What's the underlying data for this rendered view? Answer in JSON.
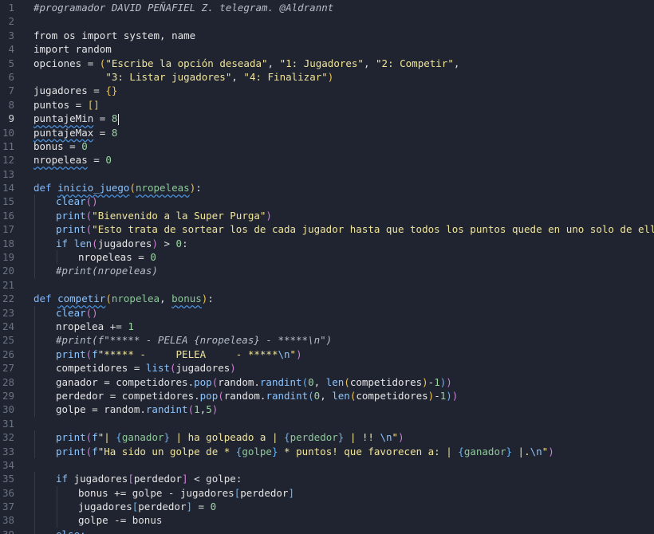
{
  "editor": {
    "active_line": 9,
    "lines": [
      {
        "n": "1",
        "indent": 0,
        "tokens": [
          {
            "t": "#programador DAVID PEÑAFIEL Z. telegram. @Aldrannt",
            "c": "t-comment"
          }
        ]
      },
      {
        "n": "2",
        "indent": 0,
        "tokens": []
      },
      {
        "n": "3",
        "indent": 0,
        "tokens": [
          {
            "t": "from",
            "c": "t-var"
          },
          {
            "t": " os ",
            "c": "t-var"
          },
          {
            "t": "import",
            "c": "t-var"
          },
          {
            "t": " system, name",
            "c": "t-var"
          }
        ]
      },
      {
        "n": "4",
        "indent": 0,
        "tokens": [
          {
            "t": "import random",
            "c": "t-var"
          }
        ]
      },
      {
        "n": "5",
        "indent": 0,
        "tokens": [
          {
            "t": "opciones",
            "c": "t-var"
          },
          {
            "t": " = ",
            "c": "t-op"
          },
          {
            "t": "(",
            "c": "t-bracket"
          },
          {
            "t": "\"Escribe la opción deseada\"",
            "c": "t-str"
          },
          {
            "t": ", ",
            "c": "t-op"
          },
          {
            "t": "\"1: Jugadores\"",
            "c": "t-str"
          },
          {
            "t": ", ",
            "c": "t-op"
          },
          {
            "t": "\"2: Competir\"",
            "c": "t-str"
          },
          {
            "t": ",",
            "c": "t-op"
          }
        ]
      },
      {
        "n": "6",
        "indent": 0,
        "tokens": [
          {
            "t": "            ",
            "c": "t-op"
          },
          {
            "t": "\"3: Listar jugadores\"",
            "c": "t-str"
          },
          {
            "t": ", ",
            "c": "t-op"
          },
          {
            "t": "\"4: Finalizar\"",
            "c": "t-str"
          },
          {
            "t": ")",
            "c": "t-bracket"
          }
        ]
      },
      {
        "n": "7",
        "indent": 0,
        "tokens": [
          {
            "t": "jugadores",
            "c": "t-var"
          },
          {
            "t": " = ",
            "c": "t-op"
          },
          {
            "t": "{}",
            "c": "t-bracket"
          }
        ]
      },
      {
        "n": "8",
        "indent": 0,
        "tokens": [
          {
            "t": "puntos",
            "c": "t-var"
          },
          {
            "t": " = ",
            "c": "t-op"
          },
          {
            "t": "[]",
            "c": "t-bracket"
          }
        ]
      },
      {
        "n": "9",
        "indent": 0,
        "tokens": [
          {
            "t": "puntajeMin",
            "c": "t-var squig"
          },
          {
            "t": " = ",
            "c": "t-op"
          },
          {
            "t": "8",
            "c": "t-num"
          }
        ]
      },
      {
        "n": "10",
        "indent": 0,
        "tokens": [
          {
            "t": "puntajeMax",
            "c": "t-var squig"
          },
          {
            "t": " = ",
            "c": "t-op"
          },
          {
            "t": "8",
            "c": "t-num"
          }
        ]
      },
      {
        "n": "11",
        "indent": 0,
        "tokens": [
          {
            "t": "bonus",
            "c": "t-var"
          },
          {
            "t": " = ",
            "c": "t-op"
          },
          {
            "t": "0",
            "c": "t-num"
          }
        ]
      },
      {
        "n": "12",
        "indent": 0,
        "tokens": [
          {
            "t": "nropeleas",
            "c": "t-var squig"
          },
          {
            "t": " = ",
            "c": "t-op"
          },
          {
            "t": "0",
            "c": "t-num"
          }
        ]
      },
      {
        "n": "13",
        "indent": 0,
        "tokens": []
      },
      {
        "n": "14",
        "indent": 0,
        "tokens": [
          {
            "t": "def",
            "c": "t-def"
          },
          {
            "t": " ",
            "c": "t-op"
          },
          {
            "t": "inicio_juego",
            "c": "t-fname squig"
          },
          {
            "t": "(",
            "c": "t-bracket"
          },
          {
            "t": "nropeleas",
            "c": "t-param squig"
          },
          {
            "t": ")",
            "c": "t-bracket"
          },
          {
            "t": ":",
            "c": "t-op"
          }
        ]
      },
      {
        "n": "15",
        "indent": 1,
        "tokens": [
          {
            "t": "clear",
            "c": "t-fn"
          },
          {
            "t": "()",
            "c": "t-bracket2"
          }
        ]
      },
      {
        "n": "16",
        "indent": 1,
        "tokens": [
          {
            "t": "print",
            "c": "t-fn"
          },
          {
            "t": "(",
            "c": "t-bracket2"
          },
          {
            "t": "\"Bienvenido a la Super Purga\"",
            "c": "t-str"
          },
          {
            "t": ")",
            "c": "t-bracket2"
          }
        ]
      },
      {
        "n": "17",
        "indent": 1,
        "tokens": [
          {
            "t": "print",
            "c": "t-fn"
          },
          {
            "t": "(",
            "c": "t-bracket2"
          },
          {
            "t": "\"Esto trata de sortear los de cada jugador hasta que todos los puntos quede en uno solo de ellos.\"",
            "c": "t-str"
          },
          {
            "t": ")",
            "c": "t-bracket2"
          }
        ]
      },
      {
        "n": "18",
        "indent": 1,
        "tokens": [
          {
            "t": "if",
            "c": "t-kw"
          },
          {
            "t": " ",
            "c": "t-op"
          },
          {
            "t": "len",
            "c": "t-fn"
          },
          {
            "t": "(",
            "c": "t-bracket2"
          },
          {
            "t": "jugadores",
            "c": "t-var"
          },
          {
            "t": ")",
            "c": "t-bracket2"
          },
          {
            "t": " > ",
            "c": "t-op"
          },
          {
            "t": "0",
            "c": "t-num"
          },
          {
            "t": ":",
            "c": "t-op"
          }
        ]
      },
      {
        "n": "19",
        "indent": 2,
        "tokens": [
          {
            "t": "nropeleas",
            "c": "t-var"
          },
          {
            "t": " = ",
            "c": "t-op"
          },
          {
            "t": "0",
            "c": "t-num"
          }
        ]
      },
      {
        "n": "20",
        "indent": 1,
        "tokens": [
          {
            "t": "#print(nropeleas)",
            "c": "t-comment"
          }
        ]
      },
      {
        "n": "21",
        "indent": 0,
        "tokens": []
      },
      {
        "n": "22",
        "indent": 0,
        "tokens": [
          {
            "t": "def",
            "c": "t-def"
          },
          {
            "t": " ",
            "c": "t-op"
          },
          {
            "t": "competir",
            "c": "t-fname squig"
          },
          {
            "t": "(",
            "c": "t-bracket"
          },
          {
            "t": "nropelea",
            "c": "t-param"
          },
          {
            "t": ", ",
            "c": "t-op"
          },
          {
            "t": "bonus",
            "c": "t-param squig"
          },
          {
            "t": ")",
            "c": "t-bracket"
          },
          {
            "t": ":",
            "c": "t-op"
          }
        ]
      },
      {
        "n": "23",
        "indent": 1,
        "tokens": [
          {
            "t": "clear",
            "c": "t-fn"
          },
          {
            "t": "()",
            "c": "t-bracket2"
          }
        ]
      },
      {
        "n": "24",
        "indent": 1,
        "tokens": [
          {
            "t": "nropelea",
            "c": "t-var"
          },
          {
            "t": " += ",
            "c": "t-op"
          },
          {
            "t": "1",
            "c": "t-num"
          }
        ]
      },
      {
        "n": "25",
        "indent": 1,
        "tokens": [
          {
            "t": "#print(f\"***** - PELEA {nropeleas} - *****\\n\")",
            "c": "t-comment"
          }
        ]
      },
      {
        "n": "26",
        "indent": 1,
        "tokens": [
          {
            "t": "print",
            "c": "t-fn"
          },
          {
            "t": "(",
            "c": "t-bracket2"
          },
          {
            "t": "f",
            "c": "t-kw"
          },
          {
            "t": "\"***** -     PELEA     - *****",
            "c": "t-str"
          },
          {
            "t": "\\n",
            "c": "t-escape"
          },
          {
            "t": "\"",
            "c": "t-str"
          },
          {
            "t": ")",
            "c": "t-bracket2"
          }
        ]
      },
      {
        "n": "27",
        "indent": 1,
        "tokens": [
          {
            "t": "competidores",
            "c": "t-var"
          },
          {
            "t": " = ",
            "c": "t-op"
          },
          {
            "t": "list",
            "c": "t-fn"
          },
          {
            "t": "(",
            "c": "t-bracket2"
          },
          {
            "t": "jugadores",
            "c": "t-var"
          },
          {
            "t": ")",
            "c": "t-bracket2"
          }
        ]
      },
      {
        "n": "28",
        "indent": 1,
        "tokens": [
          {
            "t": "ganador",
            "c": "t-var"
          },
          {
            "t": " = competidores.",
            "c": "t-op"
          },
          {
            "t": "pop",
            "c": "t-fn"
          },
          {
            "t": "(",
            "c": "t-bracket2"
          },
          {
            "t": "random.",
            "c": "t-var"
          },
          {
            "t": "randint",
            "c": "t-fn"
          },
          {
            "t": "(",
            "c": "t-bracket3"
          },
          {
            "t": "0",
            "c": "t-num"
          },
          {
            "t": ", ",
            "c": "t-op"
          },
          {
            "t": "len",
            "c": "t-fn"
          },
          {
            "t": "(",
            "c": "t-bracket"
          },
          {
            "t": "competidores",
            "c": "t-var"
          },
          {
            "t": ")",
            "c": "t-bracket"
          },
          {
            "t": "-",
            "c": "t-op"
          },
          {
            "t": "1",
            "c": "t-num"
          },
          {
            "t": ")",
            "c": "t-bracket3"
          },
          {
            "t": ")",
            "c": "t-bracket2"
          }
        ]
      },
      {
        "n": "29",
        "indent": 1,
        "tokens": [
          {
            "t": "perdedor",
            "c": "t-var"
          },
          {
            "t": " = competidores.",
            "c": "t-op"
          },
          {
            "t": "pop",
            "c": "t-fn"
          },
          {
            "t": "(",
            "c": "t-bracket2"
          },
          {
            "t": "random.",
            "c": "t-var"
          },
          {
            "t": "randint",
            "c": "t-fn"
          },
          {
            "t": "(",
            "c": "t-bracket3"
          },
          {
            "t": "0",
            "c": "t-num"
          },
          {
            "t": ", ",
            "c": "t-op"
          },
          {
            "t": "len",
            "c": "t-fn"
          },
          {
            "t": "(",
            "c": "t-bracket"
          },
          {
            "t": "competidores",
            "c": "t-var"
          },
          {
            "t": ")",
            "c": "t-bracket"
          },
          {
            "t": "-",
            "c": "t-op"
          },
          {
            "t": "1",
            "c": "t-num"
          },
          {
            "t": ")",
            "c": "t-bracket3"
          },
          {
            "t": ")",
            "c": "t-bracket2"
          }
        ]
      },
      {
        "n": "30",
        "indent": 1,
        "tokens": [
          {
            "t": "golpe",
            "c": "t-var"
          },
          {
            "t": " = random.",
            "c": "t-op"
          },
          {
            "t": "randint",
            "c": "t-fn"
          },
          {
            "t": "(",
            "c": "t-bracket2"
          },
          {
            "t": "1",
            "c": "t-num"
          },
          {
            "t": ",",
            "c": "t-op"
          },
          {
            "t": "5",
            "c": "t-num"
          },
          {
            "t": ")",
            "c": "t-bracket2"
          }
        ]
      },
      {
        "n": "31",
        "indent": 0,
        "tokens": []
      },
      {
        "n": "32",
        "indent": 1,
        "tokens": [
          {
            "t": "print",
            "c": "t-fn"
          },
          {
            "t": "(",
            "c": "t-bracket2"
          },
          {
            "t": "f",
            "c": "t-kw"
          },
          {
            "t": "\"| ",
            "c": "t-str"
          },
          {
            "t": "{",
            "c": "t-bracket3"
          },
          {
            "t": "ganador",
            "c": "t-param"
          },
          {
            "t": "}",
            "c": "t-bracket3"
          },
          {
            "t": " | ha golpeado a | ",
            "c": "t-str"
          },
          {
            "t": "{",
            "c": "t-bracket3"
          },
          {
            "t": "perdedor",
            "c": "t-param"
          },
          {
            "t": "}",
            "c": "t-bracket3"
          },
          {
            "t": " | !! ",
            "c": "t-str"
          },
          {
            "t": "\\n",
            "c": "t-escape"
          },
          {
            "t": "\"",
            "c": "t-str"
          },
          {
            "t": ")",
            "c": "t-bracket2"
          }
        ]
      },
      {
        "n": "33",
        "indent": 1,
        "tokens": [
          {
            "t": "print",
            "c": "t-fn"
          },
          {
            "t": "(",
            "c": "t-bracket2"
          },
          {
            "t": "f",
            "c": "t-kw"
          },
          {
            "t": "\"Ha sido un golpe de * ",
            "c": "t-str"
          },
          {
            "t": "{",
            "c": "t-bracket3"
          },
          {
            "t": "golpe",
            "c": "t-param"
          },
          {
            "t": "}",
            "c": "t-bracket3"
          },
          {
            "t": " * puntos! que favorecen a: | ",
            "c": "t-str"
          },
          {
            "t": "{",
            "c": "t-bracket3"
          },
          {
            "t": "ganador",
            "c": "t-param"
          },
          {
            "t": "}",
            "c": "t-bracket3"
          },
          {
            "t": " |.",
            "c": "t-str"
          },
          {
            "t": "\\n",
            "c": "t-escape"
          },
          {
            "t": "\"",
            "c": "t-str"
          },
          {
            "t": ")",
            "c": "t-bracket2"
          }
        ]
      },
      {
        "n": "34",
        "indent": 0,
        "tokens": []
      },
      {
        "n": "35",
        "indent": 1,
        "tokens": [
          {
            "t": "if",
            "c": "t-kw"
          },
          {
            "t": " jugadores",
            "c": "t-var"
          },
          {
            "t": "[",
            "c": "t-bracket2"
          },
          {
            "t": "perdedor",
            "c": "t-var"
          },
          {
            "t": "]",
            "c": "t-bracket2"
          },
          {
            "t": " < golpe:",
            "c": "t-op"
          }
        ]
      },
      {
        "n": "36",
        "indent": 2,
        "tokens": [
          {
            "t": "bonus",
            "c": "t-var"
          },
          {
            "t": " += golpe - jugadores",
            "c": "t-op"
          },
          {
            "t": "[",
            "c": "t-bracket3"
          },
          {
            "t": "perdedor",
            "c": "t-var"
          },
          {
            "t": "]",
            "c": "t-bracket3"
          }
        ]
      },
      {
        "n": "37",
        "indent": 2,
        "tokens": [
          {
            "t": "jugadores",
            "c": "t-var"
          },
          {
            "t": "[",
            "c": "t-bracket3"
          },
          {
            "t": "perdedor",
            "c": "t-var"
          },
          {
            "t": "]",
            "c": "t-bracket3"
          },
          {
            "t": " = ",
            "c": "t-op"
          },
          {
            "t": "0",
            "c": "t-num"
          }
        ]
      },
      {
        "n": "38",
        "indent": 2,
        "tokens": [
          {
            "t": "golpe",
            "c": "t-var"
          },
          {
            "t": " -= bonus",
            "c": "t-op"
          }
        ]
      },
      {
        "n": "39",
        "indent": 1,
        "tokens": [
          {
            "t": "else:",
            "c": "t-kw"
          }
        ]
      }
    ]
  }
}
